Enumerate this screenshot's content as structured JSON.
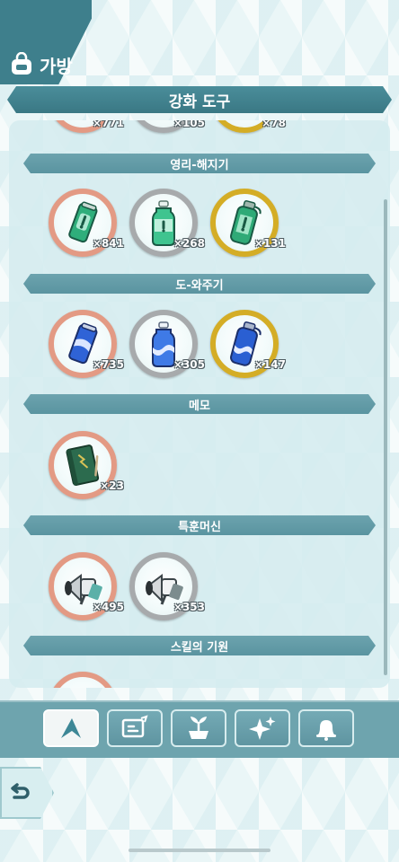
{
  "header": {
    "title": "가방",
    "icon": "bag-icon"
  },
  "section": {
    "title": "강화 도구"
  },
  "partial_row": [
    {
      "count": "×771",
      "tier": "bronze"
    },
    {
      "count": "×105",
      "tier": "silver"
    },
    {
      "count": "×78",
      "tier": "gold"
    }
  ],
  "categories": [
    {
      "title": "영리-해지기",
      "items": [
        {
          "count": "×841",
          "tier": "bronze",
          "icon": "green-can-icon"
        },
        {
          "count": "×268",
          "tier": "silver",
          "icon": "green-bottle-icon"
        },
        {
          "count": "×131",
          "tier": "gold",
          "icon": "green-flask-icon"
        }
      ]
    },
    {
      "title": "도-와주기",
      "items": [
        {
          "count": "×735",
          "tier": "bronze",
          "icon": "blue-can-icon"
        },
        {
          "count": "×305",
          "tier": "silver",
          "icon": "blue-bottle-icon"
        },
        {
          "count": "×147",
          "tier": "gold",
          "icon": "blue-flask-icon"
        }
      ]
    },
    {
      "title": "메모",
      "items": [
        {
          "count": "×23",
          "tier": "bronze",
          "icon": "memo-book-icon"
        }
      ]
    },
    {
      "title": "특훈머신",
      "items": [
        {
          "count": "×495",
          "tier": "bronze",
          "icon": "megaphone-icon"
        },
        {
          "count": "×353",
          "tier": "silver",
          "icon": "megaphone-silver-icon"
        }
      ]
    },
    {
      "title": "스킬의 기원",
      "items": []
    }
  ],
  "toolbar": {
    "buttons": [
      {
        "icon": "level-up-arrow-icon",
        "active": true
      },
      {
        "icon": "skill-card-icon",
        "active": false
      },
      {
        "icon": "evolution-plant-icon",
        "active": false
      },
      {
        "icon": "sparkle-icon",
        "active": false
      },
      {
        "icon": "bell-icon",
        "active": false
      }
    ]
  },
  "back_button": {
    "icon": "return-arrow-icon"
  },
  "colors": {
    "bronze": "#e9927f",
    "silver": "#a7aaac",
    "gold": "#d4ad26",
    "header": "#3e7f8c",
    "toolbar": "#6ea4ae"
  }
}
